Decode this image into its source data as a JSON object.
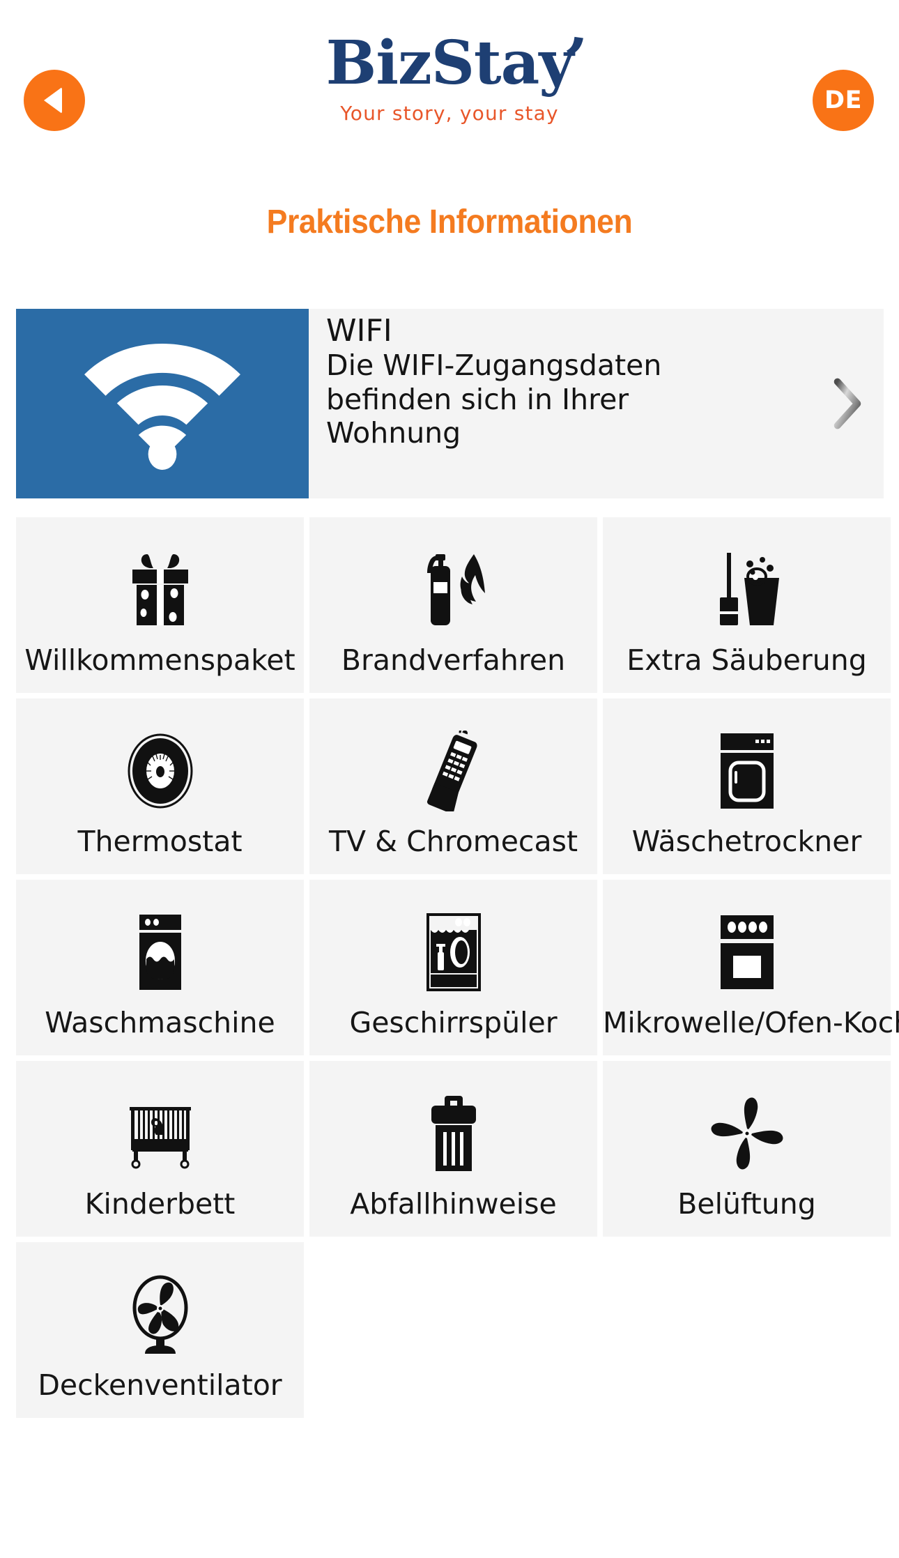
{
  "header": {
    "back_icon": "triangle-left-icon",
    "language_label": "DE",
    "logo_text": "BizStay",
    "logo_tagline": "Your story, your stay"
  },
  "page_title": "Praktische Informationen",
  "wifi_card": {
    "icon": "wifi-icon",
    "title": "WIFI",
    "description": "Die WIFI-Zugangsdaten befinden sich in Ihrer Wohnung",
    "chevron_icon": "chevron-right-icon"
  },
  "tiles": [
    {
      "label": "Willkommenspaket",
      "icon": "gift-box-icon"
    },
    {
      "label": "Brandverfahren",
      "icon": "fire-extinguisher-icon"
    },
    {
      "label": "Extra Säuberung",
      "icon": "mop-bucket-icon"
    },
    {
      "label": "Thermostat",
      "icon": "thermostat-dial-icon"
    },
    {
      "label": "TV & Chromecast",
      "icon": "remote-control-icon"
    },
    {
      "label": "Wäschetrockner",
      "icon": "tumble-dryer-icon"
    },
    {
      "label": "Waschmaschine",
      "icon": "washing-machine-icon"
    },
    {
      "label": "Geschirrspüler",
      "icon": "dishwasher-icon"
    },
    {
      "label": "Mikrowelle/Ofen-Kochfeld",
      "icon": "oven-stove-icon"
    },
    {
      "label": "Kinderbett",
      "icon": "baby-crib-icon"
    },
    {
      "label": "Abfallhinweise",
      "icon": "trash-bin-icon"
    },
    {
      "label": "Belüftung",
      "icon": "propeller-fan-icon"
    },
    {
      "label": "Deckenventilator",
      "icon": "pedestal-fan-icon"
    }
  ],
  "colors": {
    "accent_orange": "#f97316",
    "title_orange": "#f47b20",
    "logo_blue": "#1e3f73",
    "wifi_blue": "#2b6ca6",
    "tile_bg": "#f4f4f4",
    "page_bg": "#ffffff"
  }
}
